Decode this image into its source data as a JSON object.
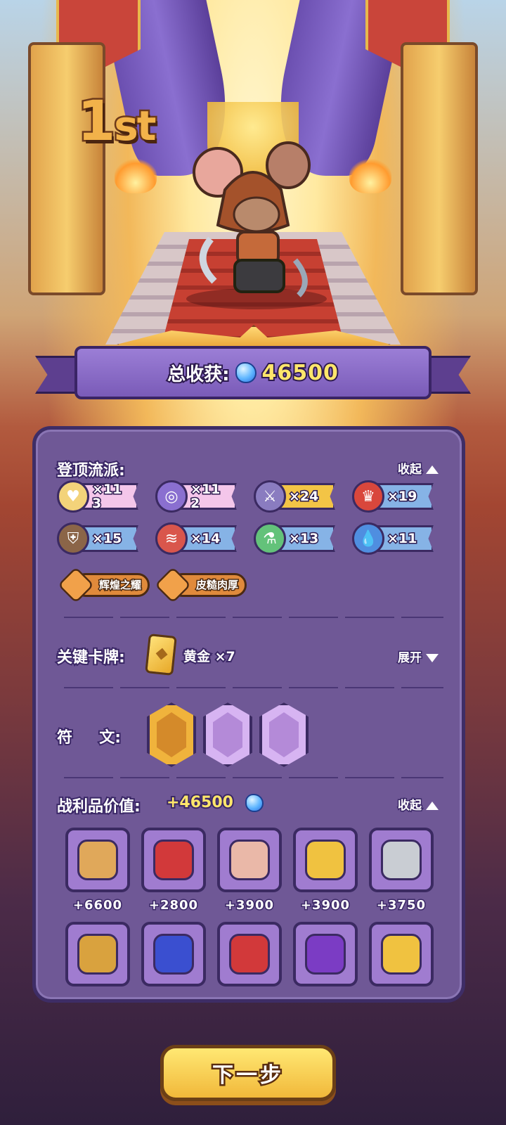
{
  "rank": {
    "num": "1",
    "suffix": "st"
  },
  "total": {
    "label": "总收获:",
    "value": "46500"
  },
  "build": {
    "title": "登顶流派:",
    "toggle": "收起",
    "tags": [
      {
        "icon": "heart-icon",
        "count": "×11 3",
        "style": "pink"
      },
      {
        "icon": "orbit-icon",
        "count": "×11 2",
        "style": "pink"
      },
      {
        "icon": "sword-icon",
        "count": "×24",
        "style": "gold"
      },
      {
        "icon": "crown-icon",
        "count": "×19",
        "style": "blue"
      },
      {
        "icon": "shield-icon",
        "count": "×15",
        "style": "blue"
      },
      {
        "icon": "claw-icon",
        "count": "×14",
        "style": "blue"
      },
      {
        "icon": "potion-icon",
        "count": "×13",
        "style": "blue"
      },
      {
        "icon": "water-drop-icon",
        "count": "×11",
        "style": "blue"
      }
    ],
    "traits": [
      {
        "label": "辉煌之耀"
      },
      {
        "label": "皮糙肉厚"
      }
    ]
  },
  "key_cards": {
    "title": "关键卡牌:",
    "card": "黄金 ×7",
    "toggle": "展开"
  },
  "runes": {
    "title": "符     文:",
    "items": [
      "scroll-rune-icon",
      "gift-rune-icon",
      "tool-rune-icon"
    ]
  },
  "loot": {
    "title": "战利品价值:",
    "value": "+46500",
    "toggle": "收起",
    "items": [
      {
        "icon": "teddy-bear-icon",
        "value": "+6600"
      },
      {
        "icon": "red-envelope-icon",
        "value": "+2800"
      },
      {
        "icon": "gift-letter-icon",
        "value": "+3900"
      },
      {
        "icon": "vip-ticket-icon",
        "value": "+3900"
      },
      {
        "icon": "key-icon",
        "value": "+3750"
      },
      {
        "icon": "padlock-icon",
        "value": ""
      },
      {
        "icon": "sapphire-icon",
        "value": ""
      },
      {
        "icon": "red-envelope-icon",
        "value": ""
      },
      {
        "icon": "candy-icon",
        "value": ""
      },
      {
        "icon": "vip-ticket-icon",
        "value": ""
      }
    ]
  },
  "next_button": "下一步",
  "colors": {
    "panel": "#6f5896",
    "accent_gold": "#ffe66b",
    "gem_blue": "#5fb6ff"
  }
}
